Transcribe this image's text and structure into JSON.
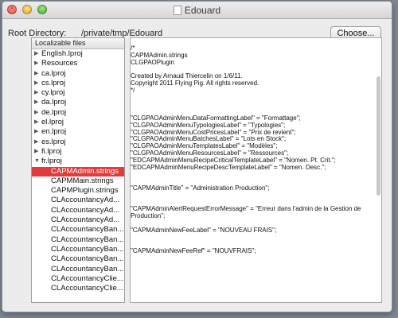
{
  "window": {
    "title": "Edouard"
  },
  "toolbar": {
    "root_label": "Root Directory:",
    "root_path": "/private/tmp/Edouard",
    "choose_label": "Choose..."
  },
  "sidebar": {
    "header": "Localizable files",
    "items": [
      {
        "label": "English.lproj",
        "expanded": false,
        "child": false
      },
      {
        "label": "Resources",
        "expanded": false,
        "child": false
      },
      {
        "label": "ca.lproj",
        "expanded": false,
        "child": false
      },
      {
        "label": "cs.lproj",
        "expanded": false,
        "child": false
      },
      {
        "label": "cy.lproj",
        "expanded": false,
        "child": false
      },
      {
        "label": "da.lproj",
        "expanded": false,
        "child": false
      },
      {
        "label": "de.lproj",
        "expanded": false,
        "child": false
      },
      {
        "label": "el.lproj",
        "expanded": false,
        "child": false
      },
      {
        "label": "en.lproj",
        "expanded": false,
        "child": false
      },
      {
        "label": "es.lproj",
        "expanded": false,
        "child": false
      },
      {
        "label": "fi.lproj",
        "expanded": false,
        "child": false
      },
      {
        "label": "fr.lproj",
        "expanded": true,
        "child": false
      },
      {
        "label": "CAPMAdmin.strings",
        "child": true,
        "selected": true
      },
      {
        "label": "CAPMMain.strings",
        "child": true
      },
      {
        "label": "CAPMPlugin.strings",
        "child": true
      },
      {
        "label": "CLAccountancyAd...",
        "child": true
      },
      {
        "label": "CLAccountancyAd...",
        "child": true
      },
      {
        "label": "CLAccountancyAd...",
        "child": true
      },
      {
        "label": "CLAccountancyBan...",
        "child": true
      },
      {
        "label": "CLAccountancyBan...",
        "child": true
      },
      {
        "label": "CLAccountancyBan...",
        "child": true
      },
      {
        "label": "CLAccountancyBan...",
        "child": true
      },
      {
        "label": "CLAccountancyBan...",
        "child": true
      },
      {
        "label": "CLAccountancyClie...",
        "child": true
      },
      {
        "label": "CLAccountancyClie...",
        "child": true
      }
    ]
  },
  "editor": {
    "lines": [
      "/*",
      "   CAPMAdmin.strings",
      "   CLGPAOPlugin",
      "",
      "   Created by Arnaud Thiercelin on 1/6/11.",
      "   Copyright 2011 Flying Pig. All rights reserved.",
      " */",
      "",
      "",
      "",
      "\"CLGPAOAdminMenuDataFormattingLabel\" = \"Formattage\";",
      "\"CLGPAOAdminMenuTypologiesLabel\" = \"Typologies\";",
      "\"CLGPAOAdminMenuCostPricesLabel\" = \"Prix de revient\";",
      "\"CLGPAOAdminMenuBatchesLabel\" = \"Lots en Stock\";",
      "\"CLGPAOAdminMenuTemplatesLabel\" = \"Modèles\";",
      "\"CLGPAOAdminMenuResourcesLabel\" = \"Ressources\";",
      "\"EDCAPMAdminMenuRecipeCriticalTemplateLabel\" = \"Nomen. Pt. Crit.\";",
      "\"EDCAPMAdminMenuRecipeDescTemplateLabel\" = \"Nomen. Desc.\";",
      "",
      "",
      "\"CAPMAdminTitle\" = \"Administration Production\";",
      "",
      "",
      "\"CAPMAdminAlertRequestErrorMessage\" = \"Erreur dans l'admin de la Gestion de",
      "Production\";",
      "",
      "\"CAPMAdminNewFeeLabel\" = \"NOUVEAU FRAIS\";",
      "",
      "",
      "\"CAPMAdminNewFeeRef\" = \"NOUVFRAIS\";"
    ]
  }
}
